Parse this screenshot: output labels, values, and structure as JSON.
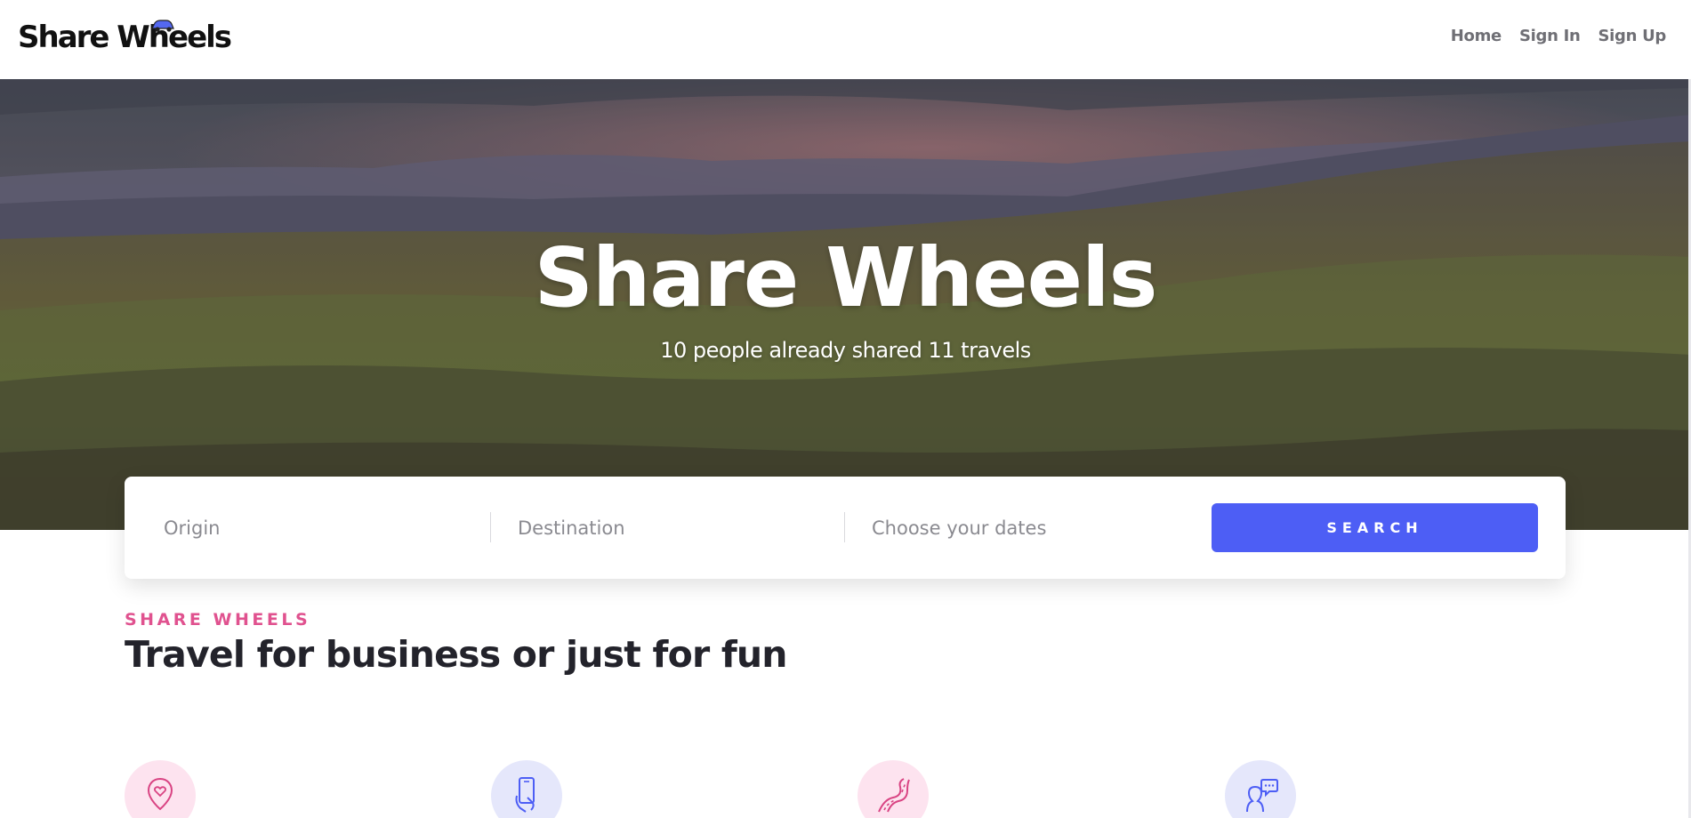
{
  "brand": {
    "name": "Share Wheels"
  },
  "nav": {
    "home": "Home",
    "sign_in": "Sign In",
    "sign_up": "Sign Up"
  },
  "hero": {
    "title": "Share Wheels",
    "subtitle": "10 people already shared 11 travels"
  },
  "search": {
    "origin_placeholder": "Origin",
    "destination_placeholder": "Destination",
    "dates_placeholder": "Choose your dates",
    "button_label": "SEARCH"
  },
  "intro": {
    "kicker": "SHARE WHEELS",
    "title": "Travel for business or just for fun"
  },
  "features": [
    {
      "icon": "location-heart-icon"
    },
    {
      "icon": "phone-hand-icon"
    },
    {
      "icon": "road-icon"
    },
    {
      "icon": "person-chat-icon"
    }
  ],
  "colors": {
    "accent_blue": "#4d5ef5",
    "accent_pink": "#e0528f",
    "pink_bg": "#fde3ef",
    "blue_bg": "#e5e7fb"
  }
}
